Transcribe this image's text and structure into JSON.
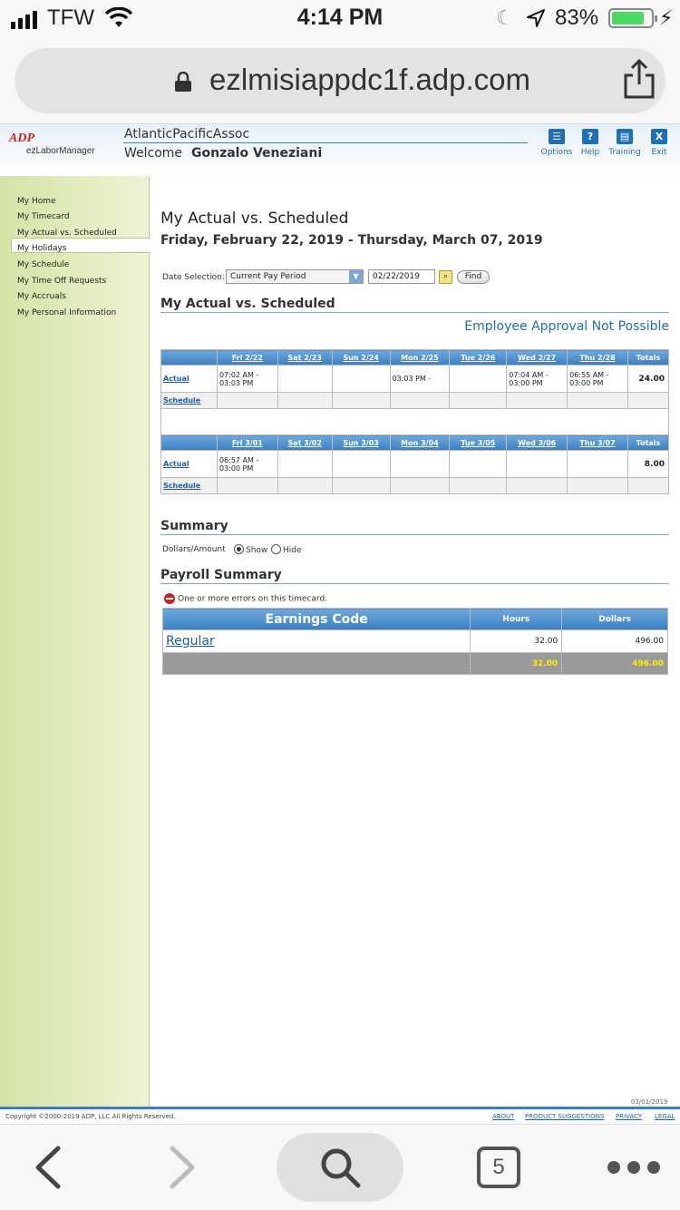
{
  "status_bar": {
    "carrier": "TFW",
    "time": "4:14 PM",
    "battery_pct": "83%",
    "battery_level": 0.83
  },
  "browser": {
    "url": "ezlmisiappdc1f.adp.com",
    "tab_count": "5"
  },
  "header": {
    "logo_text": "ADP",
    "product": "ezLaborManager",
    "company": "AtlanticPacificAssoc",
    "welcome_label": "Welcome",
    "user_name": "Gonzalo Veneziani",
    "nav": [
      {
        "label": "Options",
        "icon": "options-icon",
        "glyph": "☰"
      },
      {
        "label": "Help",
        "icon": "help-icon",
        "glyph": "?"
      },
      {
        "label": "Training",
        "icon": "training-icon",
        "glyph": "▤"
      },
      {
        "label": "Exit",
        "icon": "exit-icon",
        "glyph": "X"
      }
    ]
  },
  "sidebar": {
    "items": [
      {
        "label": "My Home"
      },
      {
        "label": "My Timecard"
      },
      {
        "label": "My Actual vs. Scheduled",
        "selected": true
      },
      {
        "label": "My Holidays"
      },
      {
        "label": "My Schedule"
      },
      {
        "label": "My Time Off Requests"
      },
      {
        "label": "My Accruals"
      },
      {
        "label": "My Personal Information"
      }
    ]
  },
  "page": {
    "title": "My Actual vs. Scheduled",
    "date_range": "Friday, February 22, 2019 - Thursday, March 07, 2019",
    "date_selection_label": "Date Selection:",
    "date_selection_value": "Current Pay Period",
    "date_input": "02/22/2019",
    "find_label": "Find",
    "section_title": "My Actual vs. Scheduled",
    "approval_text": "Employee Approval Not Possible"
  },
  "schedule": {
    "weeks": [
      {
        "days": [
          "Fri 2/22",
          "Sat 2/23",
          "Sun 2/24",
          "Mon 2/25",
          "Tue 2/26",
          "Wed 2/27",
          "Thu 2/28"
        ],
        "totals_label": "Totals",
        "actual_label": "Actual",
        "schedule_label": "Schedule",
        "actual": [
          "07:02 AM - 03:03 PM",
          "",
          "",
          "03:03 PM -",
          "",
          "07:04 AM - 03:00 PM",
          "06:55 AM - 03:00 PM"
        ],
        "actual_total": "24.00"
      },
      {
        "days": [
          "Fri 3/01",
          "Sat 3/02",
          "Sun 3/03",
          "Mon 3/04",
          "Tue 3/05",
          "Wed 3/06",
          "Thu 3/07"
        ],
        "totals_label": "Totals",
        "actual_label": "Actual",
        "schedule_label": "Schedule",
        "actual": [
          "06:57 AM - 03:00 PM",
          "",
          "",
          "",
          "",
          "",
          ""
        ],
        "actual_total": "8.00"
      }
    ]
  },
  "summary": {
    "title": "Summary",
    "dollars_label": "Dollars/Amount",
    "show_label": "Show",
    "hide_label": "Hide"
  },
  "payroll": {
    "title": "Payroll Summary",
    "error_text": "One or more errors on this timecard.",
    "headers": {
      "code": "Earnings Code",
      "hours": "Hours",
      "dollars": "Dollars"
    },
    "rows": [
      {
        "code": "Regular",
        "hours": "32.00",
        "dollars": "496.00"
      }
    ],
    "totals": {
      "hours": "32.00",
      "dollars": "496.00"
    }
  },
  "footer": {
    "page_date": "03/01/2019",
    "copyright": "Copyright ©2000-2019 ADP, LLC All Rights Reserved.",
    "links": [
      "ABOUT",
      "PRODUCT SUGGESTIONS",
      "PRIVACY",
      "LEGAL"
    ]
  },
  "colors": {
    "adp_red": "#d2232a",
    "link_blue": "#1f6fb3",
    "header_blue": "#3a7fc1",
    "sidebar_green": "#d5e3a6",
    "total_yellow": "#ffeb00"
  }
}
